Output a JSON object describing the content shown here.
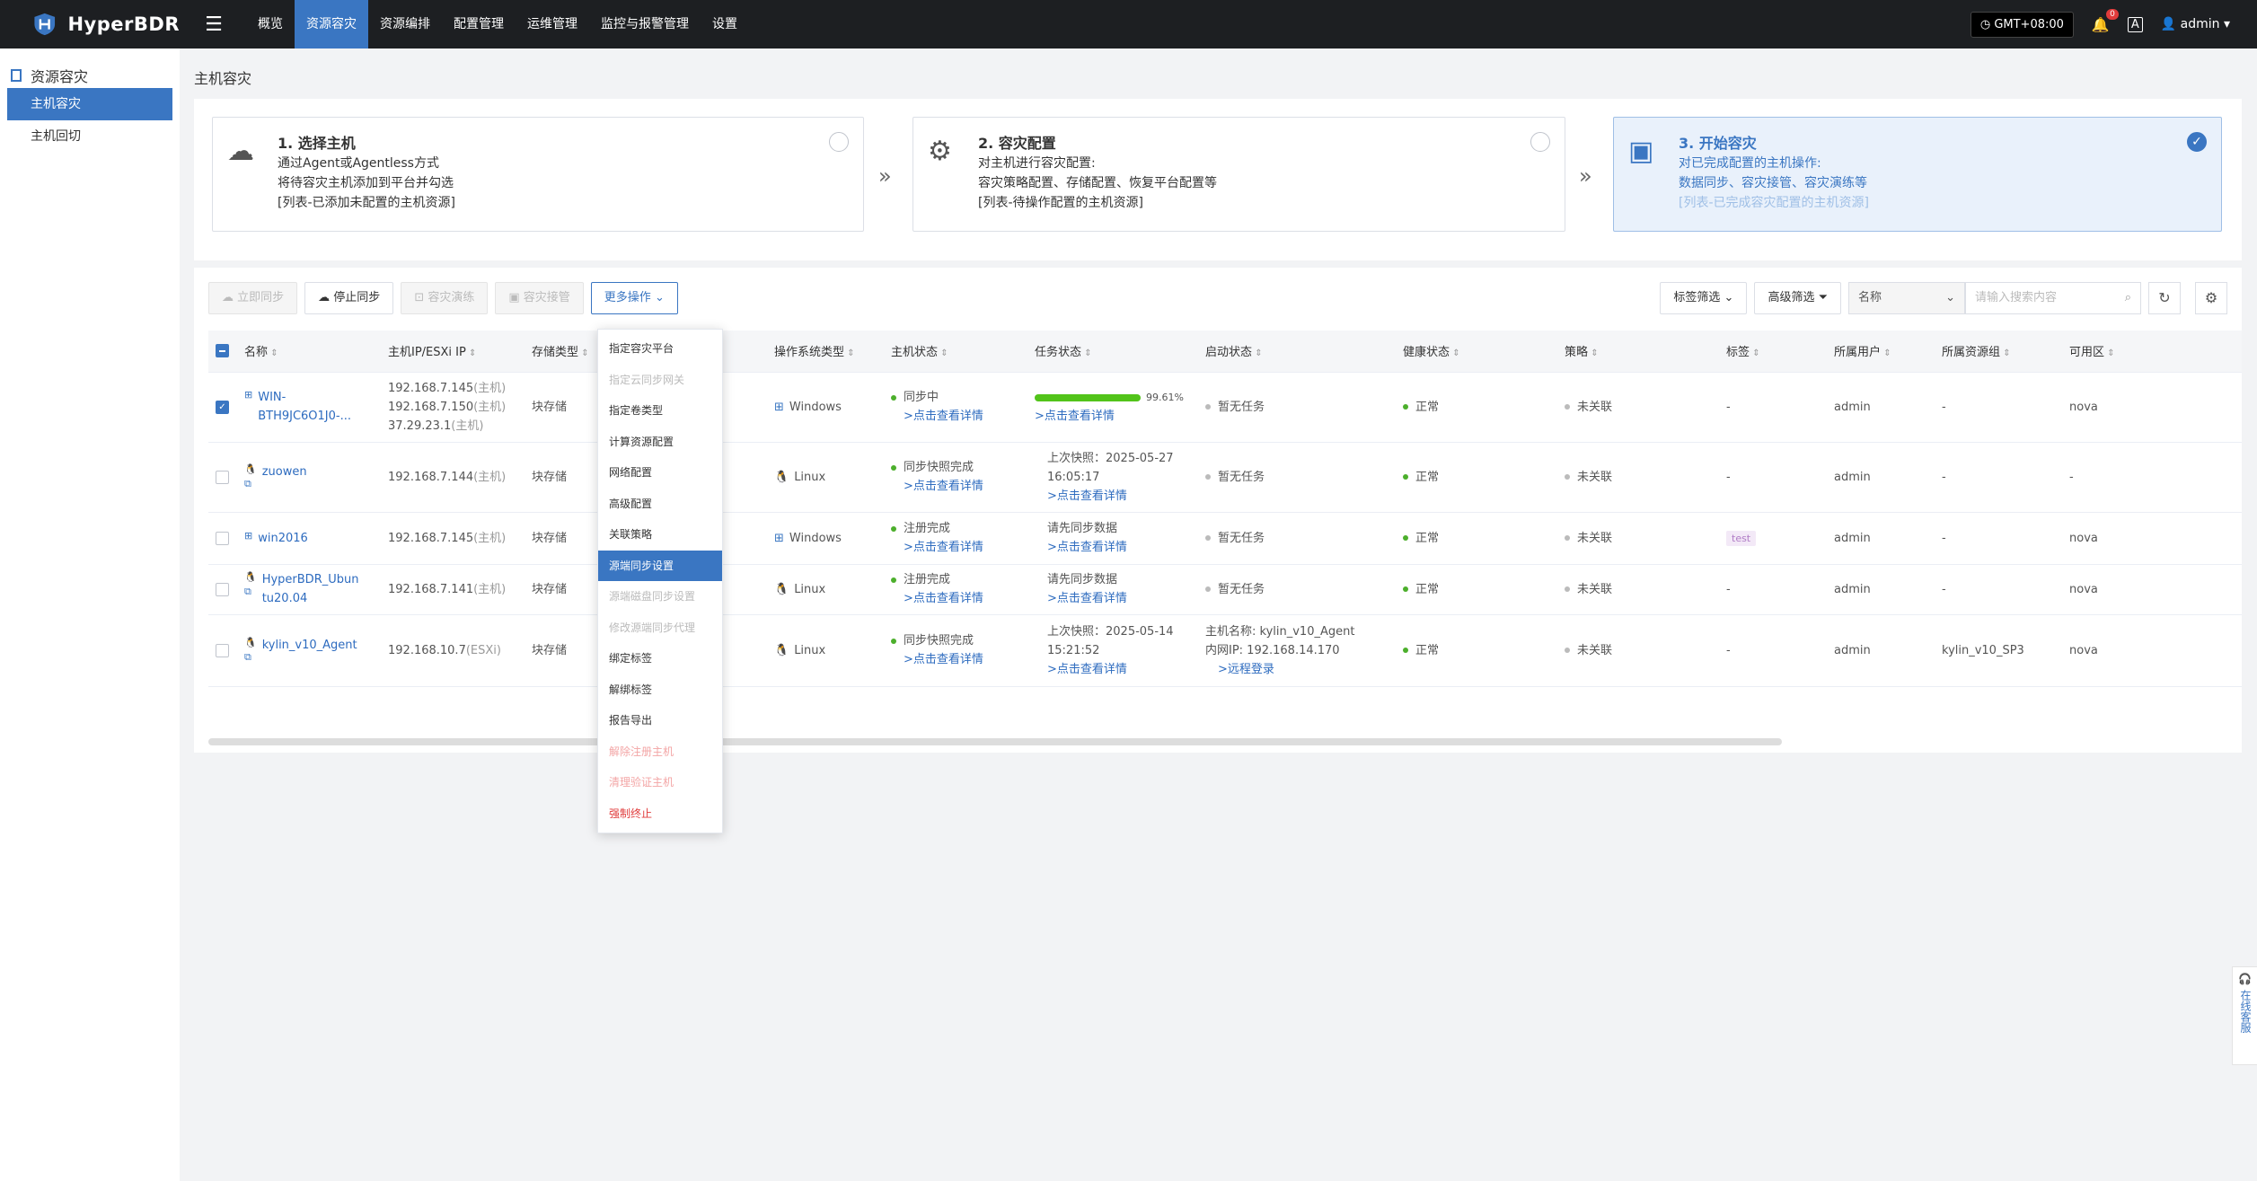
{
  "app": {
    "name": "HyperBDR"
  },
  "topbar": {
    "nav": [
      "概览",
      "资源容灾",
      "资源编排",
      "配置管理",
      "运维管理",
      "监控与报警管理",
      "设置"
    ],
    "active_nav": "资源容灾",
    "timezone": "GMT+08:00",
    "alert_count": "0",
    "user": "admin"
  },
  "sidebar": {
    "title": "资源容灾",
    "items": [
      {
        "label": "主机容灾",
        "active": true
      },
      {
        "label": "主机回切",
        "active": false
      }
    ]
  },
  "page_title": "主机容灾",
  "steps": [
    {
      "title": "1. 选择主机",
      "lines": [
        "通过Agent或Agentless方式",
        "将待容灾主机添加到平台并勾选",
        "[列表-已添加未配置的主机资源]"
      ],
      "checked": false
    },
    {
      "title": "2. 容灾配置",
      "lines": [
        "对主机进行容灾配置:",
        "容灾策略配置、存储配置、恢复平台配置等",
        "[列表-待操作配置的主机资源]"
      ],
      "checked": false
    },
    {
      "title": "3. 开始容灾",
      "lines": [
        "对已完成配置的主机操作:",
        "数据同步、容灾接管、容灾演练等",
        "[列表-已完成容灾配置的主机资源]"
      ],
      "checked": true
    }
  ],
  "toolbar": {
    "sync_now": "立即同步",
    "stop_sync": "停止同步",
    "dr_drill": "容灾演练",
    "dr_takeover": "容灾接管",
    "more_ops": "更多操作",
    "tag_filter": "标签筛选",
    "adv_filter": "高级筛选",
    "search_field": "名称",
    "search_placeholder": "请输入搜索内容"
  },
  "table": {
    "headers": [
      "名称",
      "主机IP/ESXi IP",
      "存储类型",
      "操作系统类型",
      "主机状态",
      "任务状态",
      "启动状态",
      "健康状态",
      "策略",
      "标签",
      "所属用户",
      "所属资源组",
      "可用区"
    ],
    "rows": [
      {
        "name_line1": "WIN-",
        "name_line2": "BTH9JC6O1J0-...",
        "ips": [
          [
            "192.168.7.145",
            "(主机)"
          ],
          [
            "192.168.7.150",
            "(主机)"
          ],
          [
            "37.29.23.1",
            "(主机)"
          ]
        ],
        "storage": "块存储",
        "os": "Windows",
        "host_status": "同步中",
        "host_link": ">点击查看详情",
        "task_progress": 0.9961,
        "task_pct": "99.61%",
        "task_lines": [],
        "task_link": ">点击查看详情",
        "boot_lines": [
          "暂无任务"
        ],
        "boot_link": "",
        "health": "正常",
        "policy": "未关联",
        "tag": "-",
        "user": "admin",
        "group": "-",
        "zone": "nova",
        "checked": true
      },
      {
        "name_line1": "zuowen",
        "name_line2": "",
        "ips": [
          [
            "192.168.7.144",
            "(主机)"
          ]
        ],
        "storage": "块存储",
        "os": "Linux",
        "host_status": "同步快照完成",
        "host_link": ">点击查看详情",
        "task_lines": [
          "上次快照：2025-05-27",
          "16:05:17"
        ],
        "task_link": ">点击查看详情",
        "boot_lines": [
          "暂无任务"
        ],
        "boot_link": "",
        "health": "正常",
        "policy": "未关联",
        "tag": "-",
        "user": "admin",
        "group": "-",
        "zone": "-",
        "checked": false
      },
      {
        "name_line1": "win2016",
        "name_line2": "",
        "ips": [
          [
            "192.168.7.145",
            "(主机)"
          ]
        ],
        "storage": "块存储",
        "os": "Windows",
        "host_status": "注册完成",
        "host_link": ">点击查看详情",
        "task_lines": [
          "请先同步数据"
        ],
        "task_link": ">点击查看详情",
        "boot_lines": [
          "暂无任务"
        ],
        "boot_link": "",
        "health": "正常",
        "policy": "未关联",
        "tag": "test",
        "user": "admin",
        "group": "-",
        "zone": "nova",
        "checked": false
      },
      {
        "name_line1": "HyperBDR_Ubun",
        "name_line2": "tu20.04",
        "ips": [
          [
            "192.168.7.141",
            "(主机)"
          ]
        ],
        "storage": "块存储",
        "os": "Linux",
        "host_status": "注册完成",
        "host_link": ">点击查看详情",
        "task_lines": [
          "请先同步数据"
        ],
        "task_link": ">点击查看详情",
        "boot_lines": [
          "暂无任务"
        ],
        "boot_link": "",
        "health": "正常",
        "policy": "未关联",
        "tag": "-",
        "user": "admin",
        "group": "-",
        "zone": "nova",
        "checked": false
      },
      {
        "name_line1": "kylin_v10_Agent",
        "name_line2": "",
        "ips": [
          [
            "192.168.10.7",
            "(ESXi)"
          ]
        ],
        "storage": "块存储",
        "os": "Linux",
        "host_status": "同步快照完成",
        "host_link": ">点击查看详情",
        "task_lines": [
          "上次快照：2025-05-14",
          "15:21:52"
        ],
        "task_link": ">点击查看详情",
        "boot_lines": [
          "主机名称: kylin_v10_Agent",
          "内网IP: 192.168.14.170"
        ],
        "boot_link": ">远程登录",
        "health": "正常",
        "policy": "未关联",
        "tag": "-",
        "user": "admin",
        "group": "kylin_v10_SP3",
        "zone": "nova",
        "checked": false
      }
    ]
  },
  "dropdown": {
    "items": [
      {
        "label": "指定容灾平台",
        "state": "normal"
      },
      {
        "label": "指定云同步网关",
        "state": "disabled"
      },
      {
        "label": "指定卷类型",
        "state": "normal"
      },
      {
        "label": "计算资源配置",
        "state": "normal"
      },
      {
        "label": "网络配置",
        "state": "normal"
      },
      {
        "label": "高级配置",
        "state": "normal"
      },
      {
        "label": "关联策略",
        "state": "normal"
      },
      {
        "label": "源端同步设置",
        "state": "active"
      },
      {
        "label": "源端磁盘同步设置",
        "state": "disabled"
      },
      {
        "label": "修改源端同步代理",
        "state": "disabled"
      },
      {
        "label": "绑定标签",
        "state": "normal"
      },
      {
        "label": "解绑标签",
        "state": "normal"
      },
      {
        "label": "报告导出",
        "state": "normal"
      },
      {
        "label": "解除注册主机",
        "state": "danger-light"
      },
      {
        "label": "清理验证主机",
        "state": "danger-light"
      },
      {
        "label": "强制终止",
        "state": "danger"
      }
    ]
  },
  "customer_service": "在线客服",
  "colors": {
    "accent": "#3a76c2",
    "topbar": "#1d1f22",
    "success": "#52c41a",
    "danger": "#e03b3b"
  }
}
